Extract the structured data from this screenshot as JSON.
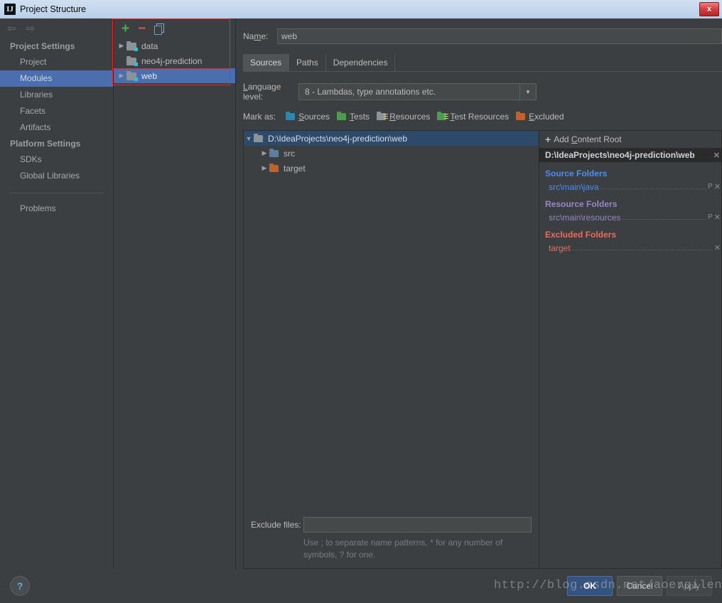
{
  "window": {
    "title": "Project Structure",
    "app_icon": "IJ",
    "close_label": "x"
  },
  "sidebar": {
    "back_icon": "⇦",
    "forward_icon": "⇨",
    "groups": [
      {
        "label": "Project Settings",
        "items": [
          {
            "label": "Project",
            "selected": false
          },
          {
            "label": "Modules",
            "selected": true
          },
          {
            "label": "Libraries",
            "selected": false
          },
          {
            "label": "Facets",
            "selected": false
          },
          {
            "label": "Artifacts",
            "selected": false
          }
        ]
      },
      {
        "label": "Platform Settings",
        "items": [
          {
            "label": "SDKs",
            "selected": false
          },
          {
            "label": "Global Libraries",
            "selected": false
          }
        ]
      }
    ],
    "problems": {
      "label": "Problems"
    }
  },
  "modules_panel": {
    "toolbar": {
      "add_label": "+",
      "remove_label": "−",
      "copy_label": "copy-icon"
    },
    "items": [
      {
        "label": "data",
        "expandable": true,
        "selected": false
      },
      {
        "label": "neo4j-prediction",
        "expandable": false,
        "selected": false
      },
      {
        "label": "web",
        "expandable": true,
        "selected": true
      }
    ]
  },
  "detail": {
    "name": {
      "label": "Name:",
      "label_pre": "Na",
      "label_u": "m",
      "label_post": "e:",
      "value": "web",
      "placeholder": ""
    },
    "tabs": [
      {
        "label": "Sources",
        "active": true
      },
      {
        "label": "Paths",
        "active": false
      },
      {
        "label": "Dependencies",
        "active": false
      }
    ],
    "language_level": {
      "label": "Language level:",
      "label_u": "L",
      "label_rest": "anguage level:",
      "value": "8 - Lambdas, type annotations etc.",
      "arrow": "▼"
    },
    "mark_as": {
      "label": "Mark as:",
      "options": [
        {
          "label": "Sources",
          "u": "S",
          "rest": "ources",
          "color": "#2e86ab",
          "lines": false
        },
        {
          "label": "Tests",
          "u": "T",
          "rest": "ests",
          "color": "#4e9a4e",
          "lines": false
        },
        {
          "label": "Resources",
          "u": "R",
          "rest": "esources",
          "color": "#8d9499",
          "lines": true
        },
        {
          "label": "Test Resources",
          "u": "T",
          "rest": "est Resources",
          "color": "#4e9a4e",
          "lines": true
        },
        {
          "label": "Excluded",
          "u": "E",
          "rest": "xcluded",
          "color": "#c0632a",
          "lines": false
        }
      ]
    },
    "tree": [
      {
        "label": "D:\\IdeaProjects\\neo4j-prediction\\web",
        "level": 0,
        "expanded": true,
        "selected": true,
        "icon_color": "#8c9398"
      },
      {
        "label": "src",
        "level": 1,
        "expanded": false,
        "selected": false,
        "icon_color": "#5b7f9e"
      },
      {
        "label": "target",
        "level": 1,
        "expanded": false,
        "selected": false,
        "icon_color": "#c0632a"
      }
    ],
    "exclude_files": {
      "label": "Exclude files:",
      "value": "",
      "placeholder": "",
      "hint": "Use ; to separate name patterns, * for any number of symbols, ? for one."
    }
  },
  "roots_right": {
    "add_content_root": {
      "label": "Add Content Root",
      "pre": "Add ",
      "u": "C",
      "rest": "ontent Root",
      "plus": "+"
    },
    "root_path": "D:\\IdeaProjects\\neo4j-prediction\\web",
    "close_icon": "✕",
    "sections": [
      {
        "title": "Source Folders",
        "color": "#4d8ef0",
        "folders": [
          {
            "path": "src\\main\\java",
            "p_btn": "P",
            "x_btn": "✕"
          }
        ]
      },
      {
        "title": "Resource Folders",
        "color": "#9a84c8",
        "folders": [
          {
            "path": "src\\main\\resources",
            "p_btn": "P",
            "x_btn": "✕"
          }
        ]
      },
      {
        "title": "Excluded Folders",
        "color": "#f06a5a",
        "folders": [
          {
            "path": "target",
            "p_btn": "",
            "x_btn": "✕"
          }
        ]
      }
    ]
  },
  "bottom": {
    "help_label": "?",
    "ok_label": "OK",
    "cancel_label": "Cancel",
    "apply_label": "Apply"
  },
  "watermark": {
    "text": "http://blog.csdn.net/aoerqileng"
  },
  "colors": {
    "accent_selection": "#4b6eaf",
    "source_blue": "#4d8ef0",
    "resource_purple": "#9a84c8",
    "excluded_red": "#f06a5a",
    "annotation_red": "#f4231f",
    "panel_bg": "#3c3f41"
  }
}
